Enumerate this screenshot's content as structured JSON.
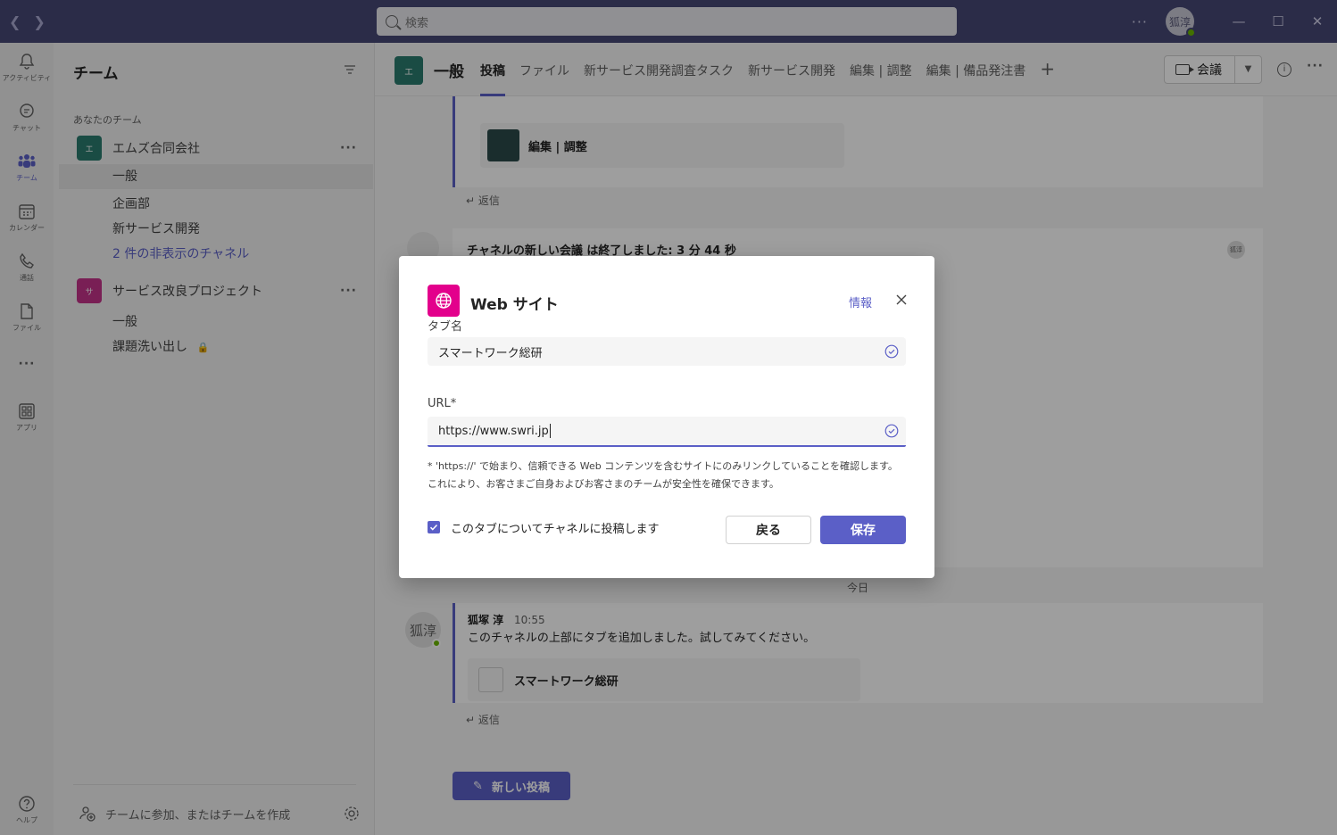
{
  "titlebar": {
    "search_placeholder": "検索",
    "avatar_text": "狐淳",
    "more": "···"
  },
  "rail": [
    {
      "label": "アクティビティ",
      "icon": "bell-icon"
    },
    {
      "label": "チャット",
      "icon": "chat-icon"
    },
    {
      "label": "チーム",
      "icon": "teams-icon"
    },
    {
      "label": "カレンダー",
      "icon": "calendar-icon"
    },
    {
      "label": "通話",
      "icon": "phone-icon"
    },
    {
      "label": "ファイル",
      "icon": "file-icon"
    },
    {
      "label": "アプリ",
      "icon": "apps-icon"
    },
    {
      "label": "ヘルプ",
      "icon": "help-icon"
    }
  ],
  "teampane": {
    "title": "チーム",
    "section": "あなたのチーム",
    "teams": [
      {
        "name": "エムズ合同会社",
        "avatar": "エ",
        "color": "#2a7b6f",
        "channels": [
          "一般",
          "企画部",
          "新サービス開発",
          "2 件の非表示のチャネル"
        ]
      },
      {
        "name": "サービス改良プロジェクト",
        "avatar": "サ",
        "color": "#c4338a",
        "channels": [
          "一般",
          "課題洗い出し"
        ]
      }
    ],
    "join": "チームに参加、またはチームを作成"
  },
  "channel": {
    "avatar": "エ",
    "name": "一般",
    "tabs": [
      "投稿",
      "ファイル",
      "新サービス開発調査タスク",
      "新サービス開発",
      "編集 | 調整",
      "編集 | 備品発注書"
    ],
    "meeting": "会議"
  },
  "feed": {
    "card1": "編集 | 調整",
    "reply": "返信",
    "meeting_ended": "チャネルの新しい会議 は終了しました: 3 分 44 秒",
    "meeting_badge": "狐淳",
    "today": "今日",
    "author": "狐塚 淳",
    "time": "10:55",
    "author_avatar": "狐淳",
    "message": "このチャネルの上部にタブを追加しました。試してみてください。",
    "card2": "スマートワーク総研",
    "new_post": "新しい投稿"
  },
  "dialog": {
    "title": "Web サイト",
    "info": "情報",
    "tab_label": "タブ名",
    "tab_value": "スマートワーク総研",
    "url_label": "URL*",
    "url_value": "https://www.swri.jp",
    "note": "* 'https://' で始まり、信頼できる Web コンテンツを含むサイトにのみリンクしていることを確認します。これにより、お客さまご自身およびお客さまのチームが安全性を確保できます。",
    "post_checkbox": "このタブについてチャネルに投稿します",
    "back": "戻る",
    "save": "保存"
  }
}
